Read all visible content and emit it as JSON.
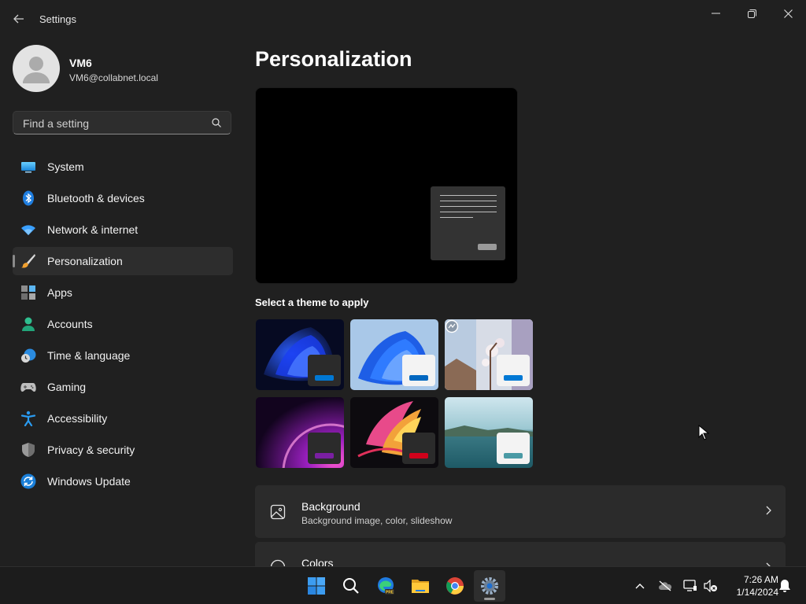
{
  "window": {
    "title": "Settings"
  },
  "user": {
    "name": "VM6",
    "email": "VM6@collabnet.local"
  },
  "search": {
    "placeholder": "Find a setting"
  },
  "nav": {
    "items": [
      {
        "label": "System",
        "icon": "system-icon"
      },
      {
        "label": "Bluetooth & devices",
        "icon": "bluetooth-icon"
      },
      {
        "label": "Network & internet",
        "icon": "wifi-icon"
      },
      {
        "label": "Personalization",
        "icon": "paintbrush-icon",
        "active": true
      },
      {
        "label": "Apps",
        "icon": "apps-icon"
      },
      {
        "label": "Accounts",
        "icon": "accounts-icon"
      },
      {
        "label": "Time & language",
        "icon": "clock-globe-icon"
      },
      {
        "label": "Gaming",
        "icon": "gamepad-icon"
      },
      {
        "label": "Accessibility",
        "icon": "accessibility-icon"
      },
      {
        "label": "Privacy & security",
        "icon": "shield-icon"
      },
      {
        "label": "Windows Update",
        "icon": "windows-update-icon"
      }
    ]
  },
  "main": {
    "title": "Personalization",
    "theme_label": "Select a theme to apply",
    "themes": [
      {
        "icon": "windows-bloom-dark-theme",
        "accent": "#0078d4"
      },
      {
        "icon": "windows-bloom-light-theme",
        "accent": "#0067c0"
      },
      {
        "icon": "spotlight-blossom-theme",
        "accent": "#0078d4"
      },
      {
        "icon": "glow-purple-theme",
        "accent": "#7a1fa2"
      },
      {
        "icon": "captured-motion-theme",
        "accent": "#d0021b"
      },
      {
        "icon": "flow-lake-theme",
        "accent": "#4a9aa5"
      }
    ],
    "cards": [
      {
        "title": "Background",
        "subtitle": "Background image, color, slideshow",
        "icon": "image-icon"
      },
      {
        "title": "Colors",
        "icon": "palette-icon"
      }
    ]
  },
  "taskbar": {
    "apps": [
      "start-icon",
      "search-icon",
      "edge-beta-icon",
      "file-explorer-icon",
      "chrome-icon",
      "settings-icon"
    ],
    "clock": {
      "time": "7:26 AM",
      "date": "1/14/2024"
    }
  },
  "colors": {
    "background": "#202020",
    "surface": "#2b2b2b",
    "accent": "#0078d4"
  }
}
